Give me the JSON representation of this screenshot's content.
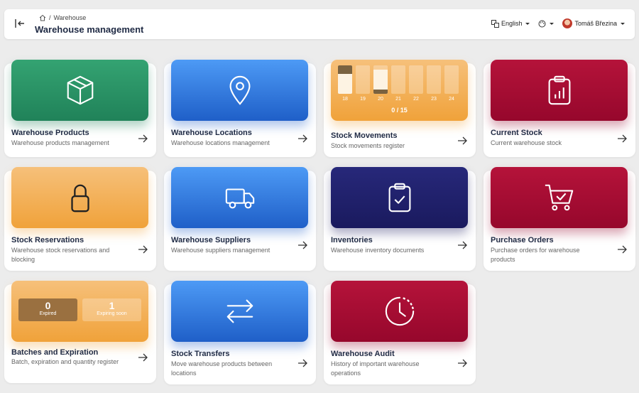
{
  "header": {
    "breadcrumb": "Warehouse",
    "title": "Warehouse management",
    "language": "English",
    "user": "Tomáš Březina"
  },
  "cards": [
    {
      "title": "Warehouse Products",
      "desc": "Warehouse products management",
      "color": "#2a9366",
      "icon": "box-icon"
    },
    {
      "title": "Warehouse Locations",
      "desc": "Warehouse locations management",
      "color": "#3a7fe0",
      "icon": "map-pin-icon"
    },
    {
      "title": "Stock Movements",
      "desc": "Stock movements register",
      "color": "#f2ad4e",
      "icon": "none"
    },
    {
      "title": "Current Stock",
      "desc": "Current warehouse stock",
      "color": "#a80d33",
      "icon": "clipboard-chart-icon"
    },
    {
      "title": "Stock Reservations",
      "desc": "Warehouse stock reservations and blocking",
      "color": "#f2ad4e",
      "icon": "lock-icon"
    },
    {
      "title": "Warehouse Suppliers",
      "desc": "Warehouse suppliers management",
      "color": "#3a7fe0",
      "icon": "truck-icon"
    },
    {
      "title": "Inventories",
      "desc": "Warehouse inventory documents",
      "color": "#21226c",
      "icon": "clipboard-check-icon"
    },
    {
      "title": "Purchase Orders",
      "desc": "Purchase orders for warehouse products",
      "color": "#a80d33",
      "icon": "cart-check-icon"
    },
    {
      "title": "Batches and Expiration",
      "desc": "Batch, expiration and quantity register",
      "color": "#f2ad4e",
      "icon": "none"
    },
    {
      "title": "Stock Transfers",
      "desc": "Move warehouse products between locations",
      "color": "#3a7fe0",
      "icon": "arrows-exchange-icon"
    },
    {
      "title": "Warehouse Audit",
      "desc": "History of important warehouse operations",
      "color": "#a80d33",
      "icon": "clock-history-icon"
    }
  ],
  "stock_movements": {
    "days": [
      "18",
      "19",
      "20",
      "21",
      "22",
      "23",
      "24"
    ],
    "count": "0 / 15"
  },
  "batches": {
    "expired_value": "0",
    "expired_label": "Expired",
    "expiring_value": "1",
    "expiring_label": "Expiring soon"
  }
}
